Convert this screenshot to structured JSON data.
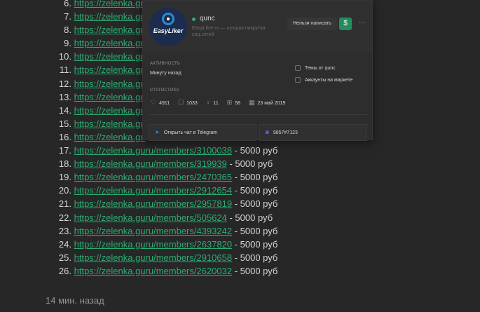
{
  "list": [
    {
      "n": "6.",
      "url": "https://zelenka.gu",
      "price": ""
    },
    {
      "n": "7.",
      "url": "https://zelenka.gu",
      "price": ""
    },
    {
      "n": "8.",
      "url": "https://zelenka.gu",
      "price": ""
    },
    {
      "n": "9.",
      "url": "https://zelenka.gu",
      "price": ""
    },
    {
      "n": "10.",
      "url": "https://zelenka.gu",
      "price": ""
    },
    {
      "n": "11.",
      "url": "https://zelenka.gu",
      "price": ""
    },
    {
      "n": "12.",
      "url": "https://zelenka.gu",
      "price": ""
    },
    {
      "n": "13.",
      "url": "https://zelenka.gu",
      "price": ""
    },
    {
      "n": "14.",
      "url": "https://zelenka.gu",
      "price": ""
    },
    {
      "n": "15.",
      "url": "https://zelenka.gu",
      "price": ""
    },
    {
      "n": "16.",
      "url": "https://zelenka.gu",
      "price": ""
    },
    {
      "n": "17.",
      "url": "https://zelenka.guru/members/3100038",
      "price": " - 5000 руб"
    },
    {
      "n": "18.",
      "url": "https://zelenka.guru/members/319939",
      "price": " - 5000 руб"
    },
    {
      "n": "19.",
      "url": "https://zelenka.guru/members/2470365",
      "price": " - 5000 руб"
    },
    {
      "n": "20.",
      "url": "https://zelenka.guru/members/2912654",
      "price": " - 5000 руб"
    },
    {
      "n": "21.",
      "url": "https://zelenka.guru/members/2957819",
      "price": " - 5000 руб"
    },
    {
      "n": "22.",
      "url": "https://zelenka.guru/members/505624",
      "price": " - 5000 руб"
    },
    {
      "n": "23.",
      "url": "https://zelenka.guru/members/4393242",
      "price": " - 5000 руб"
    },
    {
      "n": "24.",
      "url": "https://zelenka.guru/members/2637820",
      "price": " - 5000 руб"
    },
    {
      "n": "25.",
      "url": "https://zelenka.guru/members/2910658",
      "price": " - 5000 руб"
    },
    {
      "n": "26.",
      "url": "https://zelenka.guru/members/2620032",
      "price": " - 5000 руб"
    }
  ],
  "post_time": "14 мин. назад",
  "card": {
    "avatar_text": "EasyLiker",
    "username": "qunc",
    "subtitle": "EasyLiker.ru — лучшая накрутка соц.сетей",
    "message_button": "Нельзя написать",
    "dollar_button": "$",
    "more_button": "···",
    "activity_label": "Активность",
    "activity_value": "Минуту назад",
    "stats_label": "Статистика",
    "topics_link": "Темы от qunc",
    "market_link": "Аккаунты на маркете",
    "stats": {
      "likes": "4911",
      "messages": "1033",
      "trophies": "11",
      "gifts": "58",
      "registered": "23 май 2019"
    },
    "telegram_button": "Открыть чат в Telegram",
    "discord_tag": "9857#7123"
  },
  "colors": {
    "link": "#2bad72",
    "background": "#272727",
    "card_bg": "#2d2d2d",
    "online": "#2bad72",
    "dollar_btn": "#228e5d"
  }
}
